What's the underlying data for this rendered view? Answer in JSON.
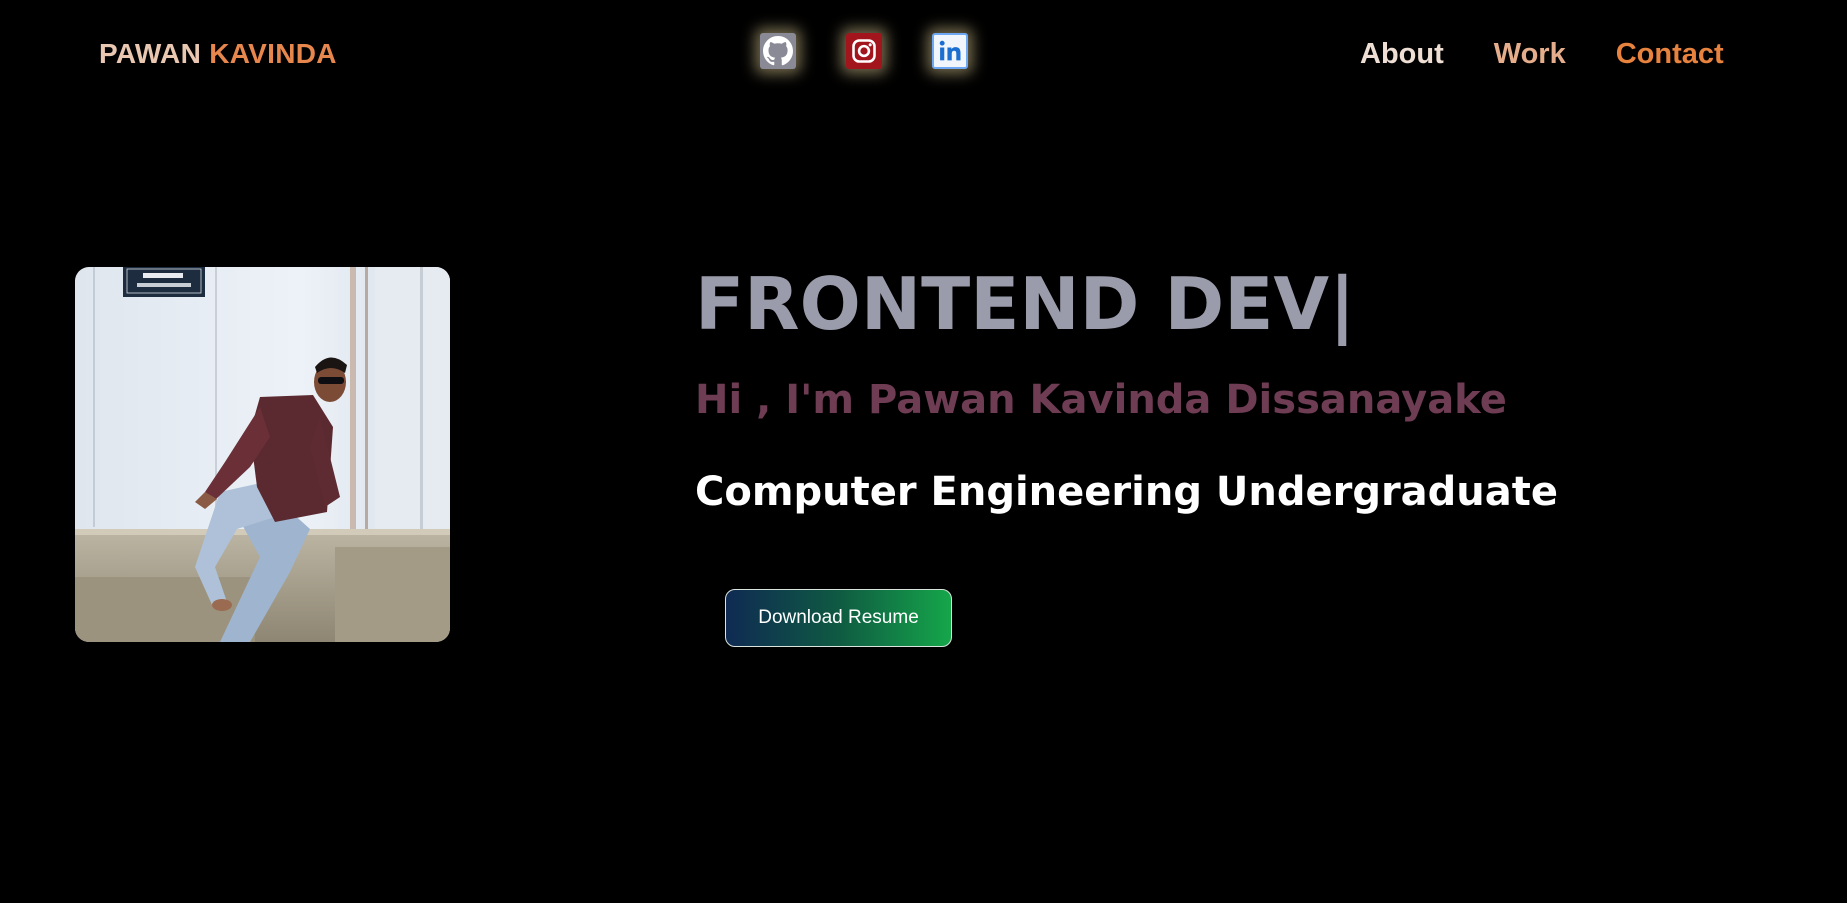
{
  "header": {
    "brand_first": "PAWAN",
    "brand_last": "KAVINDA",
    "socials": [
      {
        "icon": "github-icon",
        "color": "#8a8a96"
      },
      {
        "icon": "instagram-icon",
        "color": "#a3151d"
      },
      {
        "icon": "linkedin-icon",
        "color": "#6ea8f2"
      }
    ],
    "nav": {
      "about": "About",
      "work": "Work",
      "contact": "Contact"
    }
  },
  "hero": {
    "headline": "FRONTEND DEV",
    "cursor": "|",
    "greeting": "Hi , I'm Pawan Kavinda Dissanayake",
    "role": "Computer Engineering Undergraduate",
    "resume_button": "Download Resume"
  },
  "colors": {
    "background": "#000000",
    "brand_first": "#e9c7b1",
    "brand_last": "#e7864d",
    "headline": "#9a9cab",
    "greeting": "#6e3c53",
    "accent_orange": "#e8823f"
  }
}
